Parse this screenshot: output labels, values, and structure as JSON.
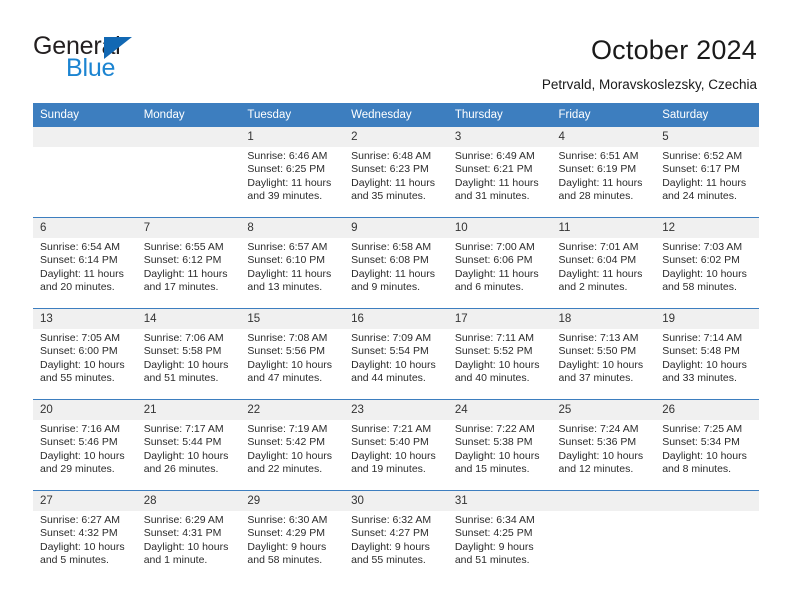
{
  "brand": {
    "name_top": "General",
    "name_bottom": "Blue",
    "accent_color": "#1c84d1",
    "triangle_color": "#1268b3",
    "triangle_icon": "triangle-icon"
  },
  "header": {
    "title": "October 2024",
    "subtitle": "Petrvald, Moravskoslezsky, Czechia"
  },
  "theme": {
    "header_blue": "#3d7ebf",
    "daynum_band": "#f0f0f0",
    "text": "#2b2b2b"
  },
  "calendar": {
    "weekday_headers": [
      "Sunday",
      "Monday",
      "Tuesday",
      "Wednesday",
      "Thursday",
      "Friday",
      "Saturday"
    ],
    "labels": {
      "sunrise": "Sunrise:",
      "sunset": "Sunset:",
      "daylight": "Daylight:"
    },
    "weeks": [
      [
        {
          "day": "",
          "empty": true
        },
        {
          "day": "",
          "empty": true
        },
        {
          "day": "1",
          "sunrise": "Sunrise: 6:46 AM",
          "sunset": "Sunset: 6:25 PM",
          "daylight_1": "Daylight: 11 hours",
          "daylight_2": "and 39 minutes."
        },
        {
          "day": "2",
          "sunrise": "Sunrise: 6:48 AM",
          "sunset": "Sunset: 6:23 PM",
          "daylight_1": "Daylight: 11 hours",
          "daylight_2": "and 35 minutes."
        },
        {
          "day": "3",
          "sunrise": "Sunrise: 6:49 AM",
          "sunset": "Sunset: 6:21 PM",
          "daylight_1": "Daylight: 11 hours",
          "daylight_2": "and 31 minutes."
        },
        {
          "day": "4",
          "sunrise": "Sunrise: 6:51 AM",
          "sunset": "Sunset: 6:19 PM",
          "daylight_1": "Daylight: 11 hours",
          "daylight_2": "and 28 minutes."
        },
        {
          "day": "5",
          "sunrise": "Sunrise: 6:52 AM",
          "sunset": "Sunset: 6:17 PM",
          "daylight_1": "Daylight: 11 hours",
          "daylight_2": "and 24 minutes."
        }
      ],
      [
        {
          "day": "6",
          "sunrise": "Sunrise: 6:54 AM",
          "sunset": "Sunset: 6:14 PM",
          "daylight_1": "Daylight: 11 hours",
          "daylight_2": "and 20 minutes."
        },
        {
          "day": "7",
          "sunrise": "Sunrise: 6:55 AM",
          "sunset": "Sunset: 6:12 PM",
          "daylight_1": "Daylight: 11 hours",
          "daylight_2": "and 17 minutes."
        },
        {
          "day": "8",
          "sunrise": "Sunrise: 6:57 AM",
          "sunset": "Sunset: 6:10 PM",
          "daylight_1": "Daylight: 11 hours",
          "daylight_2": "and 13 minutes."
        },
        {
          "day": "9",
          "sunrise": "Sunrise: 6:58 AM",
          "sunset": "Sunset: 6:08 PM",
          "daylight_1": "Daylight: 11 hours",
          "daylight_2": "and 9 minutes."
        },
        {
          "day": "10",
          "sunrise": "Sunrise: 7:00 AM",
          "sunset": "Sunset: 6:06 PM",
          "daylight_1": "Daylight: 11 hours",
          "daylight_2": "and 6 minutes."
        },
        {
          "day": "11",
          "sunrise": "Sunrise: 7:01 AM",
          "sunset": "Sunset: 6:04 PM",
          "daylight_1": "Daylight: 11 hours",
          "daylight_2": "and 2 minutes."
        },
        {
          "day": "12",
          "sunrise": "Sunrise: 7:03 AM",
          "sunset": "Sunset: 6:02 PM",
          "daylight_1": "Daylight: 10 hours",
          "daylight_2": "and 58 minutes."
        }
      ],
      [
        {
          "day": "13",
          "sunrise": "Sunrise: 7:05 AM",
          "sunset": "Sunset: 6:00 PM",
          "daylight_1": "Daylight: 10 hours",
          "daylight_2": "and 55 minutes."
        },
        {
          "day": "14",
          "sunrise": "Sunrise: 7:06 AM",
          "sunset": "Sunset: 5:58 PM",
          "daylight_1": "Daylight: 10 hours",
          "daylight_2": "and 51 minutes."
        },
        {
          "day": "15",
          "sunrise": "Sunrise: 7:08 AM",
          "sunset": "Sunset: 5:56 PM",
          "daylight_1": "Daylight: 10 hours",
          "daylight_2": "and 47 minutes."
        },
        {
          "day": "16",
          "sunrise": "Sunrise: 7:09 AM",
          "sunset": "Sunset: 5:54 PM",
          "daylight_1": "Daylight: 10 hours",
          "daylight_2": "and 44 minutes."
        },
        {
          "day": "17",
          "sunrise": "Sunrise: 7:11 AM",
          "sunset": "Sunset: 5:52 PM",
          "daylight_1": "Daylight: 10 hours",
          "daylight_2": "and 40 minutes."
        },
        {
          "day": "18",
          "sunrise": "Sunrise: 7:13 AM",
          "sunset": "Sunset: 5:50 PM",
          "daylight_1": "Daylight: 10 hours",
          "daylight_2": "and 37 minutes."
        },
        {
          "day": "19",
          "sunrise": "Sunrise: 7:14 AM",
          "sunset": "Sunset: 5:48 PM",
          "daylight_1": "Daylight: 10 hours",
          "daylight_2": "and 33 minutes."
        }
      ],
      [
        {
          "day": "20",
          "sunrise": "Sunrise: 7:16 AM",
          "sunset": "Sunset: 5:46 PM",
          "daylight_1": "Daylight: 10 hours",
          "daylight_2": "and 29 minutes."
        },
        {
          "day": "21",
          "sunrise": "Sunrise: 7:17 AM",
          "sunset": "Sunset: 5:44 PM",
          "daylight_1": "Daylight: 10 hours",
          "daylight_2": "and 26 minutes."
        },
        {
          "day": "22",
          "sunrise": "Sunrise: 7:19 AM",
          "sunset": "Sunset: 5:42 PM",
          "daylight_1": "Daylight: 10 hours",
          "daylight_2": "and 22 minutes."
        },
        {
          "day": "23",
          "sunrise": "Sunrise: 7:21 AM",
          "sunset": "Sunset: 5:40 PM",
          "daylight_1": "Daylight: 10 hours",
          "daylight_2": "and 19 minutes."
        },
        {
          "day": "24",
          "sunrise": "Sunrise: 7:22 AM",
          "sunset": "Sunset: 5:38 PM",
          "daylight_1": "Daylight: 10 hours",
          "daylight_2": "and 15 minutes."
        },
        {
          "day": "25",
          "sunrise": "Sunrise: 7:24 AM",
          "sunset": "Sunset: 5:36 PM",
          "daylight_1": "Daylight: 10 hours",
          "daylight_2": "and 12 minutes."
        },
        {
          "day": "26",
          "sunrise": "Sunrise: 7:25 AM",
          "sunset": "Sunset: 5:34 PM",
          "daylight_1": "Daylight: 10 hours",
          "daylight_2": "and 8 minutes."
        }
      ],
      [
        {
          "day": "27",
          "sunrise": "Sunrise: 6:27 AM",
          "sunset": "Sunset: 4:32 PM",
          "daylight_1": "Daylight: 10 hours",
          "daylight_2": "and 5 minutes."
        },
        {
          "day": "28",
          "sunrise": "Sunrise: 6:29 AM",
          "sunset": "Sunset: 4:31 PM",
          "daylight_1": "Daylight: 10 hours",
          "daylight_2": "and 1 minute."
        },
        {
          "day": "29",
          "sunrise": "Sunrise: 6:30 AM",
          "sunset": "Sunset: 4:29 PM",
          "daylight_1": "Daylight: 9 hours",
          "daylight_2": "and 58 minutes."
        },
        {
          "day": "30",
          "sunrise": "Sunrise: 6:32 AM",
          "sunset": "Sunset: 4:27 PM",
          "daylight_1": "Daylight: 9 hours",
          "daylight_2": "and 55 minutes."
        },
        {
          "day": "31",
          "sunrise": "Sunrise: 6:34 AM",
          "sunset": "Sunset: 4:25 PM",
          "daylight_1": "Daylight: 9 hours",
          "daylight_2": "and 51 minutes."
        },
        {
          "day": "",
          "empty": true
        },
        {
          "day": "",
          "empty": true
        }
      ]
    ]
  }
}
